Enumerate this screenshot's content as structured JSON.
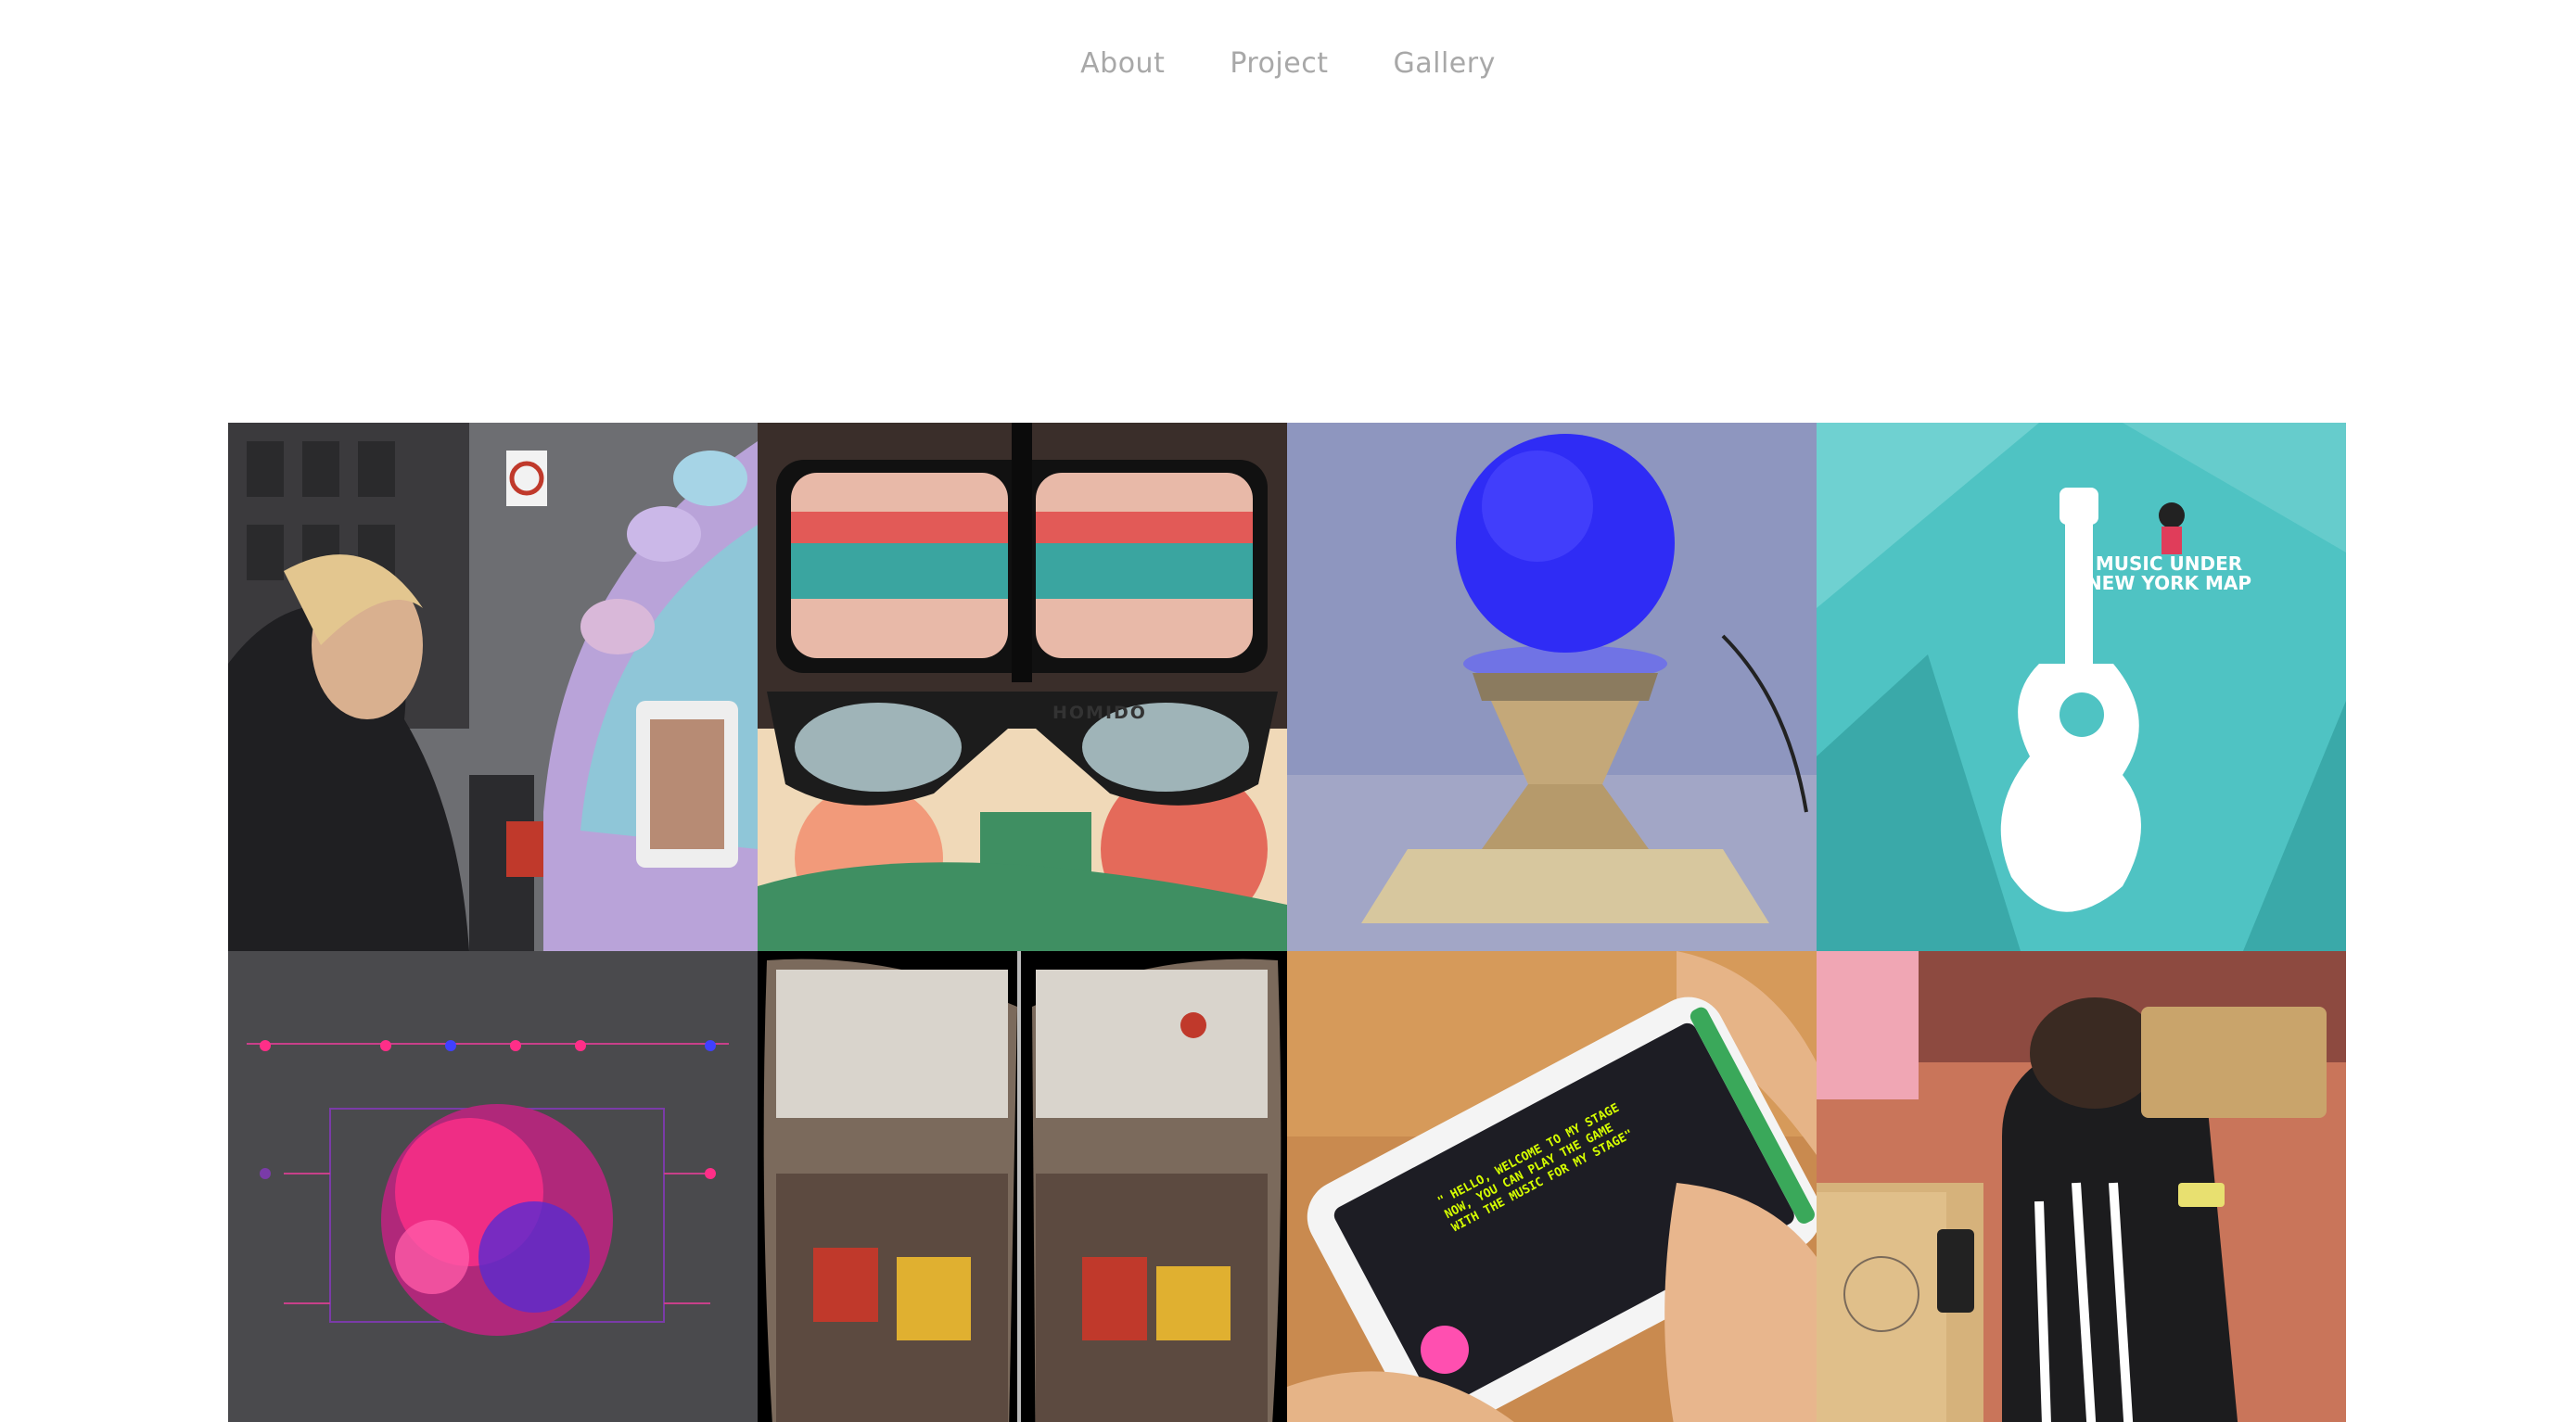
{
  "nav": {
    "items": [
      {
        "label": "About"
      },
      {
        "label": "Project"
      },
      {
        "label": "Gallery"
      }
    ]
  },
  "gallery": {
    "tiles": [
      {
        "icon": "street-installation-photo"
      },
      {
        "icon": "vr-headset-photo",
        "label": "HOMIDO"
      },
      {
        "icon": "glowing-orb-photo"
      },
      {
        "icon": "guitar-map-poster",
        "label": "MUSIC UNDER NEW YORK MAP"
      },
      {
        "icon": "particle-sphere-render"
      },
      {
        "icon": "vr-street-view-photo"
      },
      {
        "icon": "phone-app-photo",
        "label": "\" HELLO, WELCOME TO MY STAGE NOW, YOU CAN PLAY THE GAME WITH THE MUSIC FOR MY STAGE\""
      },
      {
        "icon": "cardboard-viewer-photo"
      }
    ]
  },
  "colors": {
    "nav_text": "#a8a8a8",
    "teal": "#4fc3c3",
    "orb_blue": "#2f2cf5",
    "particle_pink": "#ff2e88"
  }
}
